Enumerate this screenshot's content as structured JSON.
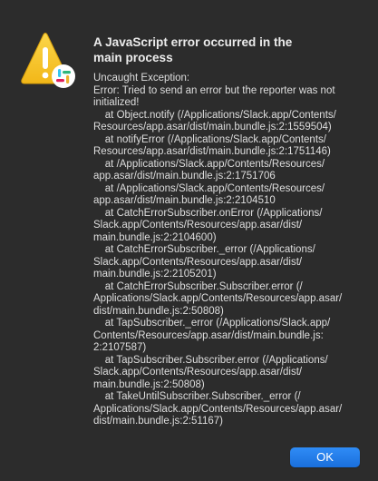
{
  "dialog": {
    "title_lines": [
      "A JavaScript error occurred in the",
      "main process"
    ],
    "message_lines": [
      "Uncaught Exception:",
      "Error: Tried to send an error but the reporter was not",
      "initialized!",
      "    at Object.notify (/Applications/Slack.app/Contents/",
      "Resources/app.asar/dist/main.bundle.js:2:1559504)",
      "    at notifyError (/Applications/Slack.app/Contents/",
      "Resources/app.asar/dist/main.bundle.js:2:1751146)",
      "    at /Applications/Slack.app/Contents/Resources/",
      "app.asar/dist/main.bundle.js:2:1751706",
      "    at /Applications/Slack.app/Contents/Resources/",
      "app.asar/dist/main.bundle.js:2:2104510",
      "    at CatchErrorSubscriber.onError (/Applications/",
      "Slack.app/Contents/Resources/app.asar/dist/",
      "main.bundle.js:2:2104600)",
      "    at CatchErrorSubscriber._error (/Applications/",
      "Slack.app/Contents/Resources/app.asar/dist/",
      "main.bundle.js:2:2105201)",
      "    at CatchErrorSubscriber.Subscriber.error (/",
      "Applications/Slack.app/Contents/Resources/app.asar/",
      "dist/main.bundle.js:2:50808)",
      "    at TapSubscriber._error (/Applications/Slack.app/",
      "Contents/Resources/app.asar/dist/main.bundle.js:",
      "2:2107587)",
      "    at TapSubscriber.Subscriber.error (/Applications/",
      "Slack.app/Contents/Resources/app.asar/dist/",
      "main.bundle.js:2:50808)",
      "    at TakeUntilSubscriber.Subscriber._error (/",
      "Applications/Slack.app/Contents/Resources/app.asar/",
      "dist/main.bundle.js:2:51167)"
    ],
    "ok_label": "OK",
    "icons": {
      "warning": "warning-triangle-icon",
      "app_badge": "slack-logo-icon"
    }
  },
  "colors": {
    "background": "#2c2c2c",
    "text": "#dedede",
    "accent": "#1a7ce8",
    "warning_yellow": "#f7c62f"
  }
}
